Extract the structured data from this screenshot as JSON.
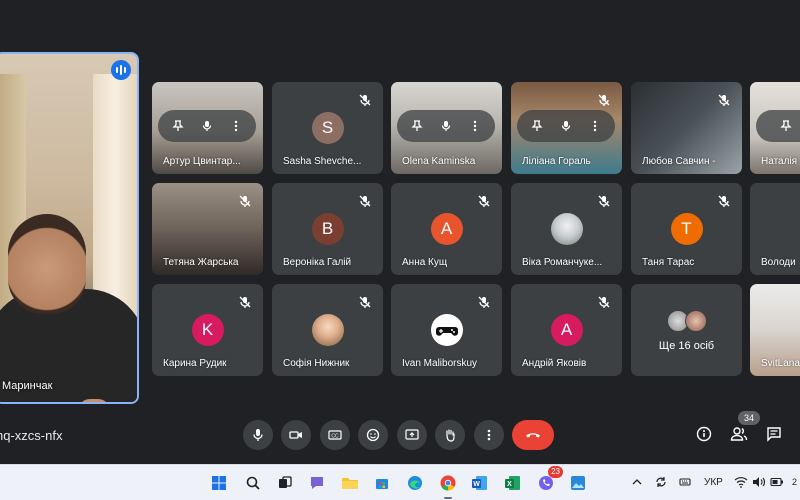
{
  "self_view": {
    "name": "Маринчак"
  },
  "tiles": [
    {
      "name": "Артур Цвинтар...",
      "kind": "video",
      "hover": true
    },
    {
      "name": "Sasha Shevche...",
      "kind": "letter",
      "letter": "S",
      "color": "#8d6e63"
    },
    {
      "name": "Olena Kaminska",
      "kind": "video",
      "hover": true
    },
    {
      "name": "Ліліана Гораль",
      "kind": "video",
      "hover": true
    },
    {
      "name": "Любов Савчин -",
      "kind": "video"
    },
    {
      "name": "Наталія",
      "kind": "video",
      "hover": true
    },
    {
      "name": "Тетяна Жарська",
      "kind": "video"
    },
    {
      "name": "Вероніка Галій",
      "kind": "letter",
      "letter": "B",
      "color": "#7b3f31"
    },
    {
      "name": "Анна Кущ",
      "kind": "letter",
      "letter": "A",
      "color": "#e8542b"
    },
    {
      "name": "Віка Романчуке...",
      "kind": "photo"
    },
    {
      "name": "Таня Тарас",
      "kind": "letter",
      "letter": "T",
      "color": "#ef6c00"
    },
    {
      "name": "Володи",
      "kind": "letter",
      "letter": "",
      "color": "#1e88e5"
    },
    {
      "name": "Карина Рудик",
      "kind": "letter",
      "letter": "K",
      "color": "#d81b60"
    },
    {
      "name": "Софія Нижник",
      "kind": "photo"
    },
    {
      "name": "Ivan Maliborskuy",
      "kind": "photo"
    },
    {
      "name": "Андрій Яковів",
      "kind": "letter",
      "letter": "A",
      "color": "#d81b60"
    },
    {
      "name": "Ще 16 осіб",
      "kind": "more"
    },
    {
      "name": "SvitLana",
      "kind": "video"
    }
  ],
  "controls": {
    "meeting_code": "hq-xzcs-nfx",
    "people_count": "34",
    "buttons": [
      "mic-icon",
      "camera-icon",
      "captions-icon",
      "emoji-icon",
      "present-icon",
      "hand-icon",
      "more-icon",
      "end-call-icon"
    ]
  },
  "taskbar": {
    "language": "УКР",
    "notification_count": "23",
    "clock_fragment": "2"
  }
}
